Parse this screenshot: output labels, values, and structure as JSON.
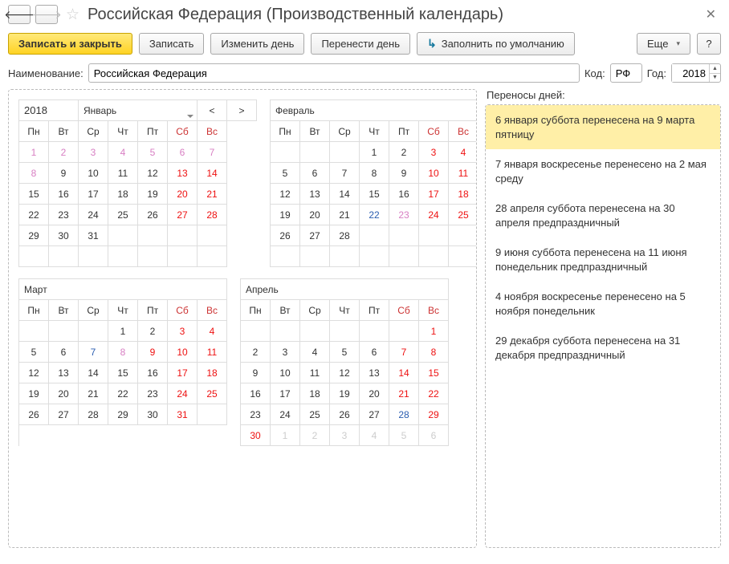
{
  "window": {
    "title": "Российская Федерация (Производственный календарь)"
  },
  "toolbar": {
    "save_close": "Записать и закрыть",
    "save": "Записать",
    "change_day": "Изменить день",
    "move_day": "Перенести день",
    "fill_default": "Заполнить по умолчанию",
    "more": "Еще",
    "help": "?"
  },
  "fields": {
    "name_label": "Наименование:",
    "name_value": "Российская Федерация",
    "code_label": "Код:",
    "code_value": "РФ",
    "year_label": "Год:",
    "year_value": "2018"
  },
  "transfers": {
    "header": "Переносы дней:",
    "items": [
      "6 января суббота перенесена на 9 марта пятницу",
      "7 января воскресенье перенесено на 2 мая среду",
      "28 апреля суббота перенесена на 30 апреля предпраздничный",
      "9 июня суббота перенесена на 11 июня понедельник предпраздничный",
      "4 ноября воскресенье перенесено на 5 ноября понедельник",
      "29 декабря суббота перенесена на 31 декабря предпраздничный"
    ],
    "selected": 0
  },
  "calendar": {
    "year": "2018",
    "dow": [
      "Пн",
      "Вт",
      "Ср",
      "Чт",
      "Пт",
      "Сб",
      "Вс"
    ],
    "nav_prev": "<",
    "nav_next": ">",
    "months": [
      {
        "name": "Январь",
        "weeks": [
          [
            {
              "n": "1",
              "t": "hol"
            },
            {
              "n": "2",
              "t": "hol"
            },
            {
              "n": "3",
              "t": "hol"
            },
            {
              "n": "4",
              "t": "hol"
            },
            {
              "n": "5",
              "t": "hol"
            },
            {
              "n": "6",
              "t": "hol"
            },
            {
              "n": "7",
              "t": "hol"
            }
          ],
          [
            {
              "n": "8",
              "t": "hol"
            },
            {
              "n": "9",
              "t": "work"
            },
            {
              "n": "10",
              "t": "work"
            },
            {
              "n": "11",
              "t": "work"
            },
            {
              "n": "12",
              "t": "work"
            },
            {
              "n": "13",
              "t": "we"
            },
            {
              "n": "14",
              "t": "we"
            }
          ],
          [
            {
              "n": "15",
              "t": "work"
            },
            {
              "n": "16",
              "t": "work"
            },
            {
              "n": "17",
              "t": "work"
            },
            {
              "n": "18",
              "t": "work"
            },
            {
              "n": "19",
              "t": "work"
            },
            {
              "n": "20",
              "t": "we"
            },
            {
              "n": "21",
              "t": "we"
            }
          ],
          [
            {
              "n": "22",
              "t": "work"
            },
            {
              "n": "23",
              "t": "work"
            },
            {
              "n": "24",
              "t": "work"
            },
            {
              "n": "25",
              "t": "work"
            },
            {
              "n": "26",
              "t": "work"
            },
            {
              "n": "27",
              "t": "we"
            },
            {
              "n": "28",
              "t": "we"
            }
          ],
          [
            {
              "n": "29",
              "t": "work"
            },
            {
              "n": "30",
              "t": "work"
            },
            {
              "n": "31",
              "t": "work"
            },
            {
              "n": "",
              "t": ""
            },
            {
              "n": "",
              "t": ""
            },
            {
              "n": "",
              "t": ""
            },
            {
              "n": "",
              "t": ""
            }
          ],
          [
            {
              "n": "",
              "t": ""
            },
            {
              "n": "",
              "t": ""
            },
            {
              "n": "",
              "t": ""
            },
            {
              "n": "",
              "t": ""
            },
            {
              "n": "",
              "t": ""
            },
            {
              "n": "",
              "t": ""
            },
            {
              "n": "",
              "t": ""
            }
          ]
        ]
      },
      {
        "name": "Февраль",
        "weeks": [
          [
            {
              "n": "",
              "t": ""
            },
            {
              "n": "",
              "t": ""
            },
            {
              "n": "",
              "t": ""
            },
            {
              "n": "1",
              "t": "work"
            },
            {
              "n": "2",
              "t": "work"
            },
            {
              "n": "3",
              "t": "we"
            },
            {
              "n": "4",
              "t": "we"
            }
          ],
          [
            {
              "n": "5",
              "t": "work"
            },
            {
              "n": "6",
              "t": "work"
            },
            {
              "n": "7",
              "t": "work"
            },
            {
              "n": "8",
              "t": "work"
            },
            {
              "n": "9",
              "t": "work"
            },
            {
              "n": "10",
              "t": "we"
            },
            {
              "n": "11",
              "t": "we"
            }
          ],
          [
            {
              "n": "12",
              "t": "work"
            },
            {
              "n": "13",
              "t": "work"
            },
            {
              "n": "14",
              "t": "work"
            },
            {
              "n": "15",
              "t": "work"
            },
            {
              "n": "16",
              "t": "work"
            },
            {
              "n": "17",
              "t": "we"
            },
            {
              "n": "18",
              "t": "we"
            }
          ],
          [
            {
              "n": "19",
              "t": "work"
            },
            {
              "n": "20",
              "t": "work"
            },
            {
              "n": "21",
              "t": "work"
            },
            {
              "n": "22",
              "t": "pre"
            },
            {
              "n": "23",
              "t": "hol"
            },
            {
              "n": "24",
              "t": "we"
            },
            {
              "n": "25",
              "t": "we"
            }
          ],
          [
            {
              "n": "26",
              "t": "work"
            },
            {
              "n": "27",
              "t": "work"
            },
            {
              "n": "28",
              "t": "work"
            },
            {
              "n": "",
              "t": ""
            },
            {
              "n": "",
              "t": ""
            },
            {
              "n": "",
              "t": ""
            },
            {
              "n": "",
              "t": ""
            }
          ],
          [
            {
              "n": "",
              "t": ""
            },
            {
              "n": "",
              "t": ""
            },
            {
              "n": "",
              "t": ""
            },
            {
              "n": "",
              "t": ""
            },
            {
              "n": "",
              "t": ""
            },
            {
              "n": "",
              "t": ""
            },
            {
              "n": "",
              "t": ""
            }
          ]
        ]
      },
      {
        "name": "Март",
        "weeks": [
          [
            {
              "n": "",
              "t": ""
            },
            {
              "n": "",
              "t": ""
            },
            {
              "n": "",
              "t": ""
            },
            {
              "n": "1",
              "t": "work"
            },
            {
              "n": "2",
              "t": "work"
            },
            {
              "n": "3",
              "t": "we"
            },
            {
              "n": "4",
              "t": "we"
            }
          ],
          [
            {
              "n": "5",
              "t": "work"
            },
            {
              "n": "6",
              "t": "work"
            },
            {
              "n": "7",
              "t": "pre"
            },
            {
              "n": "8",
              "t": "hol"
            },
            {
              "n": "9",
              "t": "we"
            },
            {
              "n": "10",
              "t": "we"
            },
            {
              "n": "11",
              "t": "we"
            }
          ],
          [
            {
              "n": "12",
              "t": "work"
            },
            {
              "n": "13",
              "t": "work"
            },
            {
              "n": "14",
              "t": "work"
            },
            {
              "n": "15",
              "t": "work"
            },
            {
              "n": "16",
              "t": "work"
            },
            {
              "n": "17",
              "t": "we"
            },
            {
              "n": "18",
              "t": "we"
            }
          ],
          [
            {
              "n": "19",
              "t": "work"
            },
            {
              "n": "20",
              "t": "work"
            },
            {
              "n": "21",
              "t": "work"
            },
            {
              "n": "22",
              "t": "work"
            },
            {
              "n": "23",
              "t": "work"
            },
            {
              "n": "24",
              "t": "we"
            },
            {
              "n": "25",
              "t": "we"
            }
          ],
          [
            {
              "n": "26",
              "t": "work"
            },
            {
              "n": "27",
              "t": "work"
            },
            {
              "n": "28",
              "t": "work"
            },
            {
              "n": "29",
              "t": "work"
            },
            {
              "n": "30",
              "t": "work"
            },
            {
              "n": "31",
              "t": "we"
            },
            {
              "n": "",
              "t": ""
            }
          ]
        ]
      },
      {
        "name": "Апрель",
        "weeks": [
          [
            {
              "n": "",
              "t": ""
            },
            {
              "n": "",
              "t": ""
            },
            {
              "n": "",
              "t": ""
            },
            {
              "n": "",
              "t": ""
            },
            {
              "n": "",
              "t": ""
            },
            {
              "n": "",
              "t": ""
            },
            {
              "n": "1",
              "t": "we"
            }
          ],
          [
            {
              "n": "2",
              "t": "work"
            },
            {
              "n": "3",
              "t": "work"
            },
            {
              "n": "4",
              "t": "work"
            },
            {
              "n": "5",
              "t": "work"
            },
            {
              "n": "6",
              "t": "work"
            },
            {
              "n": "7",
              "t": "we"
            },
            {
              "n": "8",
              "t": "we"
            }
          ],
          [
            {
              "n": "9",
              "t": "work"
            },
            {
              "n": "10",
              "t": "work"
            },
            {
              "n": "11",
              "t": "work"
            },
            {
              "n": "12",
              "t": "work"
            },
            {
              "n": "13",
              "t": "work"
            },
            {
              "n": "14",
              "t": "we"
            },
            {
              "n": "15",
              "t": "we"
            }
          ],
          [
            {
              "n": "16",
              "t": "work"
            },
            {
              "n": "17",
              "t": "work"
            },
            {
              "n": "18",
              "t": "work"
            },
            {
              "n": "19",
              "t": "work"
            },
            {
              "n": "20",
              "t": "work"
            },
            {
              "n": "21",
              "t": "we"
            },
            {
              "n": "22",
              "t": "we"
            }
          ],
          [
            {
              "n": "23",
              "t": "work"
            },
            {
              "n": "24",
              "t": "work"
            },
            {
              "n": "25",
              "t": "work"
            },
            {
              "n": "26",
              "t": "work"
            },
            {
              "n": "27",
              "t": "work"
            },
            {
              "n": "28",
              "t": "pre"
            },
            {
              "n": "29",
              "t": "we"
            }
          ],
          [
            {
              "n": "30",
              "t": "we"
            },
            {
              "n": "1",
              "t": "out"
            },
            {
              "n": "2",
              "t": "out"
            },
            {
              "n": "3",
              "t": "out"
            },
            {
              "n": "4",
              "t": "out"
            },
            {
              "n": "5",
              "t": "out"
            },
            {
              "n": "6",
              "t": "out"
            }
          ]
        ]
      }
    ]
  }
}
